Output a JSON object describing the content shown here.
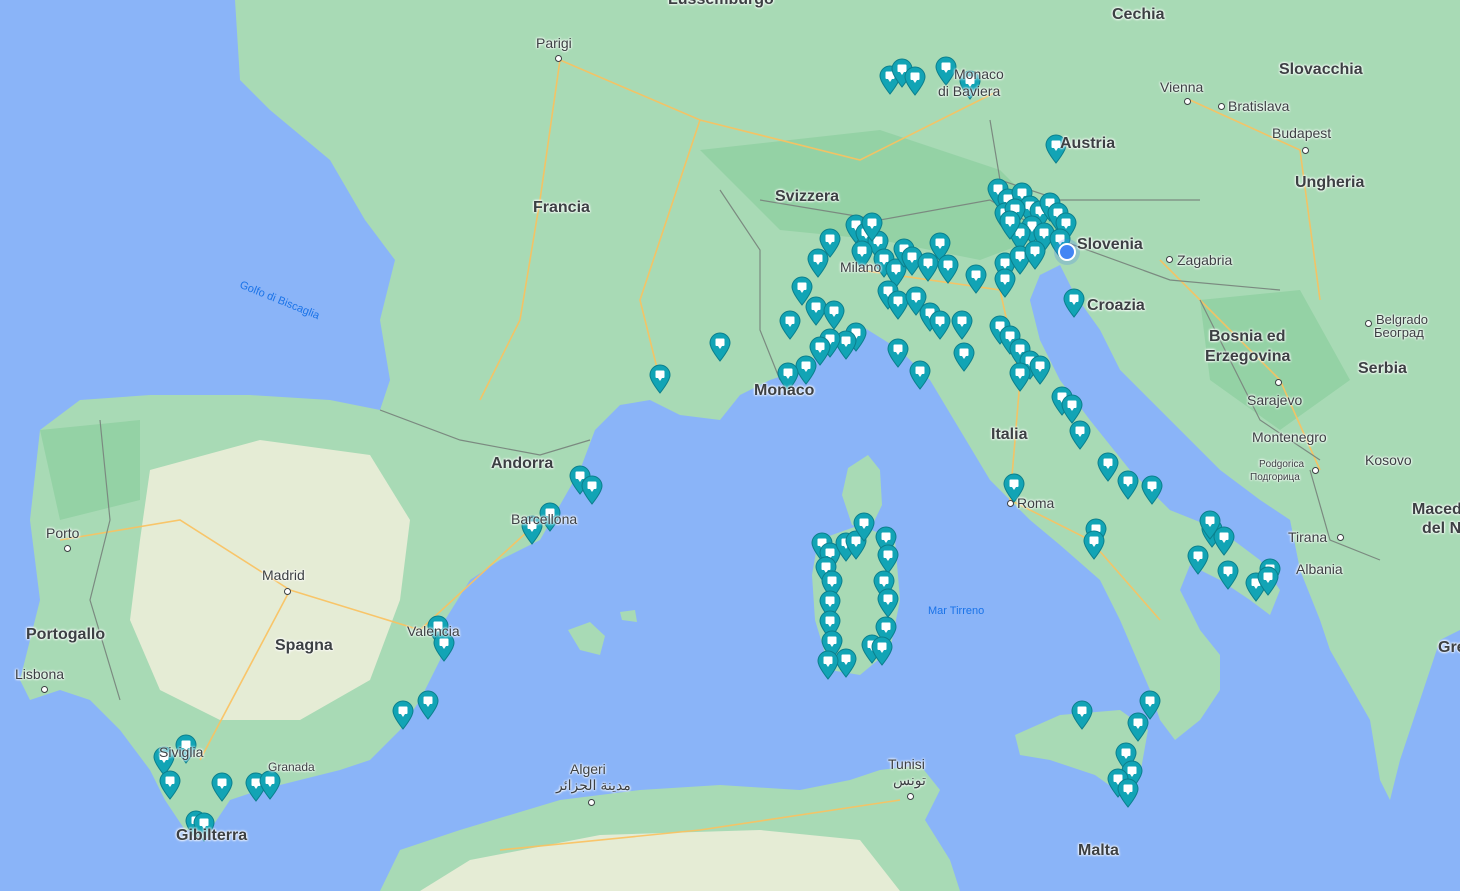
{
  "colors": {
    "sea": "#8ab4f8",
    "land": "#a8dab5",
    "land_dry": "#f0eedb",
    "forest": "#94d2a5",
    "road": "#fbc15e",
    "border": "#7b8a80",
    "marker": "#12a4b5"
  },
  "labels": {
    "countries": [
      {
        "id": "france",
        "text": "Francia"
      },
      {
        "id": "switzerland",
        "text": "Svizzera"
      },
      {
        "id": "italy",
        "text": "Italia"
      },
      {
        "id": "spain",
        "text": "Spagna"
      },
      {
        "id": "portugal",
        "text": "Portogallo"
      },
      {
        "id": "andorra",
        "text": "Andorra"
      },
      {
        "id": "monaco",
        "text": "Monaco"
      },
      {
        "id": "austria",
        "text": "Austria"
      },
      {
        "id": "slovenia",
        "text": "Slovenia"
      },
      {
        "id": "croatia",
        "text": "Croazia"
      },
      {
        "id": "czechia",
        "text": "Cechia"
      },
      {
        "id": "slovakia",
        "text": "Slovacchia"
      },
      {
        "id": "hungary",
        "text": "Ungheria"
      },
      {
        "id": "bosnia_1",
        "text": "Bosnia ed"
      },
      {
        "id": "bosnia_2",
        "text": "Erzegovina"
      },
      {
        "id": "serbia",
        "text": "Serbia"
      },
      {
        "id": "montenegro",
        "text": "Montenegro"
      },
      {
        "id": "kosovo",
        "text": "Kosovo"
      },
      {
        "id": "macedonia_1",
        "text": "Macedonia"
      },
      {
        "id": "macedonia_2",
        "text": "del Nord"
      },
      {
        "id": "albania",
        "text": "Albania"
      },
      {
        "id": "greece",
        "text": "Gre"
      },
      {
        "id": "malta",
        "text": "Malta"
      },
      {
        "id": "luxembourg",
        "text": "Lussemburgo"
      }
    ],
    "cities": [
      {
        "id": "paris",
        "text": "Parigi"
      },
      {
        "id": "madrid",
        "text": "Madrid"
      },
      {
        "id": "lisbon",
        "text": "Lisbona"
      },
      {
        "id": "porto",
        "text": "Porto"
      },
      {
        "id": "barcelona",
        "text": "Barcellona"
      },
      {
        "id": "valencia",
        "text": "Valencia"
      },
      {
        "id": "seville",
        "text": "Siviglia"
      },
      {
        "id": "granada",
        "text": "Granada"
      },
      {
        "id": "gibraltar",
        "text": "Gibilterra"
      },
      {
        "id": "rome",
        "text": "Roma"
      },
      {
        "id": "milan",
        "text": "Milano"
      },
      {
        "id": "munich_1",
        "text": "Monaco"
      },
      {
        "id": "munich_2",
        "text": "di Baviera"
      },
      {
        "id": "vienna",
        "text": "Vienna"
      },
      {
        "id": "bratislava",
        "text": "Bratislava"
      },
      {
        "id": "budapest",
        "text": "Budapest"
      },
      {
        "id": "zagreb",
        "text": "Zagabria"
      },
      {
        "id": "belgrade_1",
        "text": "Belgrado"
      },
      {
        "id": "belgrade_2",
        "text": "Београд"
      },
      {
        "id": "sarajevo",
        "text": "Sarajevo"
      },
      {
        "id": "podgorica_1",
        "text": "Podgorica"
      },
      {
        "id": "podgorica_2",
        "text": "Подгорица"
      },
      {
        "id": "tirana",
        "text": "Tirana"
      },
      {
        "id": "algiers_1",
        "text": "Algeri"
      },
      {
        "id": "algiers_2",
        "text": "مدينة الجزائر"
      },
      {
        "id": "tunis_1",
        "text": "Tunisi"
      },
      {
        "id": "tunis_2",
        "text": "تونس"
      }
    ],
    "seas": [
      {
        "id": "biscay",
        "text": "Golfo di Biscaglia"
      },
      {
        "id": "tyrrhenian",
        "text": "Mar Tirreno"
      }
    ]
  },
  "icons": {
    "place_marker": "map-pin-icon",
    "current_location": "blue-dot-icon"
  },
  "marker_count": 128
}
